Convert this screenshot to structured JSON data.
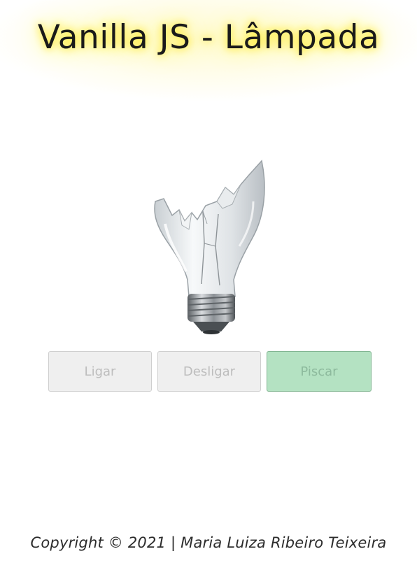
{
  "header": {
    "title": "Vanilla JS - Lâmpada"
  },
  "lamp": {
    "state": "broken",
    "image_icon": "broken-light-bulb-icon"
  },
  "controls": {
    "on_label": "Ligar",
    "off_label": "Desligar",
    "blink_label": "Piscar"
  },
  "footer": {
    "copyright": "Copyright © 2021 | Maria Luiza Ribeiro Teixeira"
  },
  "colors": {
    "title_glow": "#ffe600",
    "button_gray": "#efefef",
    "button_green": "#b4e2c2"
  }
}
